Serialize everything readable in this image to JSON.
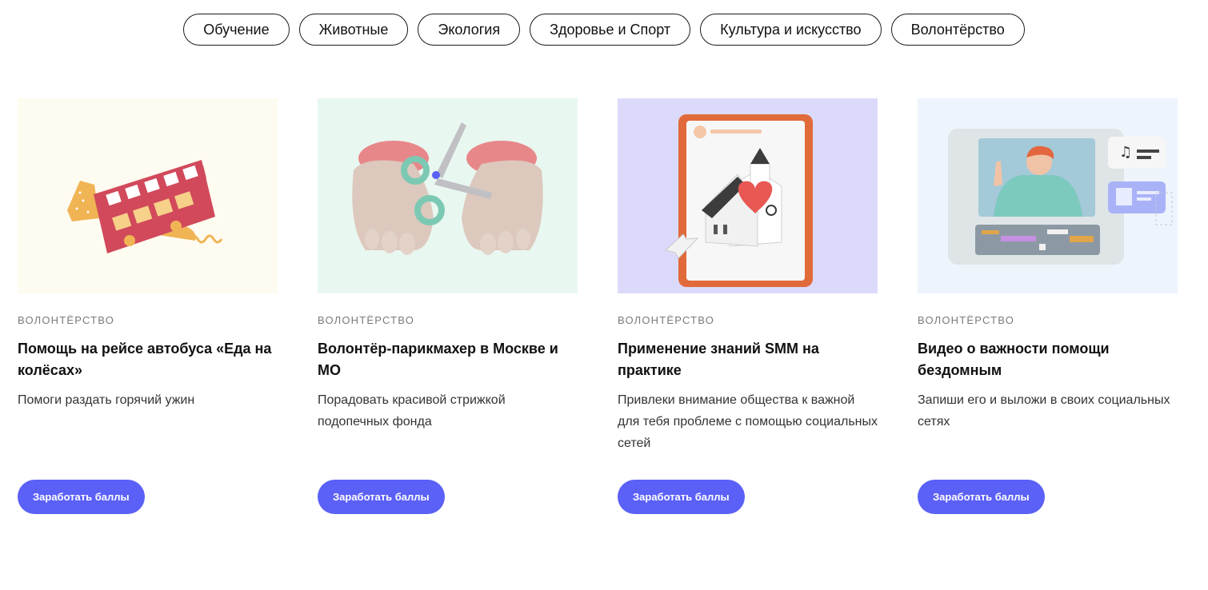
{
  "filters": [
    "Обучение",
    "Животные",
    "Экология",
    "Здоровье и Спорт",
    "Культура и искусство",
    "Волонтёрство"
  ],
  "cards": [
    {
      "tag": "Волонтёрство",
      "title": "Помощь на рейсе автобуса «Еда на колёсах»",
      "description": "Помоги раздать горячий ужин",
      "button": "Заработать баллы",
      "image_bg": "#fefbf0",
      "image_icon": "bus-illustration-icon"
    },
    {
      "tag": "Волонтёрство",
      "title": "Волонтёр-парикмахер в Москве и МО",
      "description": "Порадовать красивой стрижкой подопечных фонда",
      "button": "Заработать баллы",
      "image_bg": "#e9f7f1",
      "image_icon": "scissors-hands-illustration-icon"
    },
    {
      "tag": "Волонтёрство",
      "title": "Применение знаний SMM на практике",
      "description": "Привлеки внимание общества к важной для тебя проблеме с помощью социальных сетей",
      "button": "Заработать баллы",
      "image_bg": "#dcdafb",
      "image_icon": "tablet-church-heart-illustration-icon"
    },
    {
      "tag": "Волонтёрство",
      "title": "Видео о важности помощи бездомным",
      "description": "Запиши его и выложи в своих социальных сетях",
      "button": "Заработать баллы",
      "image_bg": "#eef4fc",
      "image_icon": "video-editor-illustration-icon"
    }
  ],
  "colors": {
    "accent": "#5b60f6",
    "chip_border": "#1a1a1a",
    "tag": "#7a7a7a"
  }
}
